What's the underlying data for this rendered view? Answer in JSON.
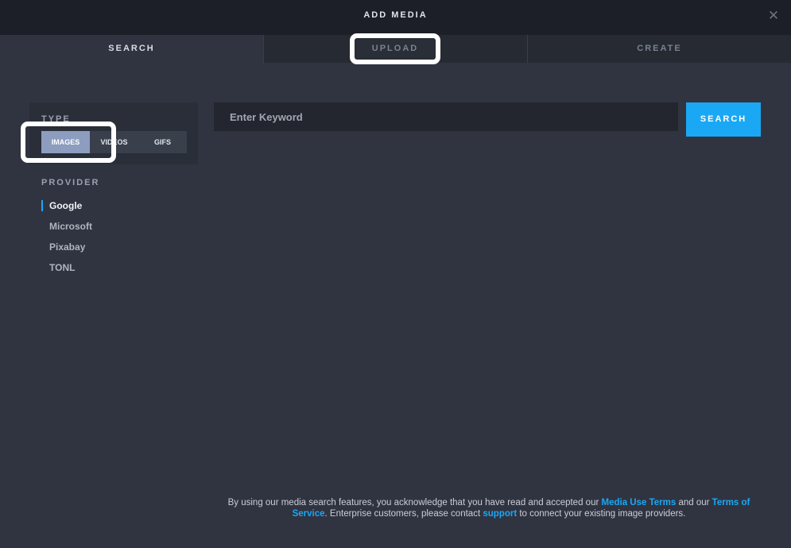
{
  "header": {
    "title": "ADD MEDIA",
    "close_label": "✕"
  },
  "tabs": [
    {
      "label": "SEARCH",
      "active": true
    },
    {
      "label": "UPLOAD",
      "active": false
    },
    {
      "label": "CREATE",
      "active": false
    }
  ],
  "type_filter": {
    "label": "TYPE",
    "options": [
      "IMAGES",
      "VIDEOS",
      "GIFS"
    ],
    "selected": "IMAGES"
  },
  "provider": {
    "label": "PROVIDER",
    "items": [
      "Google",
      "Microsoft",
      "Pixabay",
      "TONL"
    ],
    "selected": "Google"
  },
  "search": {
    "placeholder": "Enter Keyword",
    "value": "",
    "button_label": "SEARCH"
  },
  "footer": {
    "text1": "By using our media search features, you acknowledge that you have read and accepted our ",
    "link1": "Media Use Terms",
    "text2": " and our ",
    "link2": "Terms of Service",
    "text3": ". Enterprise customers, please contact ",
    "link3": "support",
    "text4": " to connect your existing image providers."
  },
  "colors": {
    "accent": "#1aa8f5",
    "background": "#303441",
    "header": "#1c1f28",
    "selected_segment": "#8c9dbf"
  }
}
